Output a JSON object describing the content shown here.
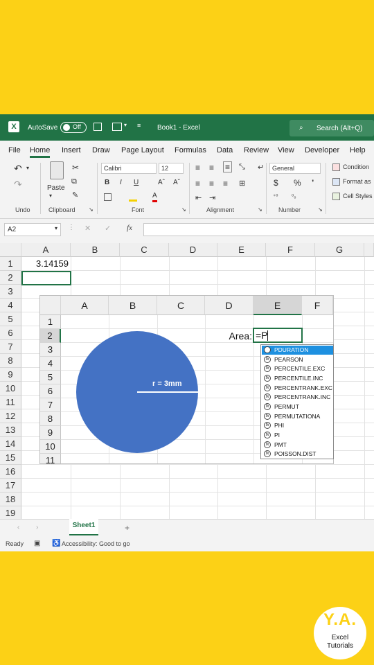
{
  "app": {
    "autosave_label": "AutoSave",
    "autosave_state": "Off",
    "title": "Book1 - Excel",
    "search_placeholder": "Search (Alt+Q)"
  },
  "menu": [
    "File",
    "Home",
    "Insert",
    "Draw",
    "Page Layout",
    "Formulas",
    "Data",
    "Review",
    "View",
    "Developer",
    "Help"
  ],
  "ribbon": {
    "groups": [
      "Undo",
      "Clipboard",
      "Font",
      "Alignment",
      "Number"
    ],
    "paste_label": "Paste",
    "font_name": "Calibri",
    "font_size": "12",
    "bold": "B",
    "italic": "I",
    "underline": "U",
    "grow_font": "Aˆ",
    "shrink_font": "Aˇ",
    "number_format": "General",
    "currency": "$",
    "percent": "%",
    "comma": "ʼ",
    "styles": [
      "Conditional Formatting",
      "Format as Table",
      "Cell Styles"
    ],
    "styles_cut": [
      "Condition",
      "Format as",
      "Cell Styles"
    ],
    "accent": "#217346"
  },
  "formula_bar": {
    "name_box": "A2",
    "fx": "fx",
    "value": ""
  },
  "sheet": {
    "columns": [
      "A",
      "B",
      "C",
      "D",
      "E",
      "F",
      "G"
    ],
    "rows": [
      "1",
      "2",
      "3",
      "4",
      "5",
      "6",
      "7",
      "8",
      "9",
      "10",
      "11",
      "12",
      "13",
      "14",
      "15",
      "16",
      "17",
      "18",
      "19"
    ],
    "a1_value": "3.14159",
    "tab_name": "Sheet1"
  },
  "status": {
    "ready": "Ready",
    "accessibility": "Accessibility: Good to go"
  },
  "zoom_view": {
    "columns": [
      "A",
      "B",
      "C",
      "D",
      "E",
      "F"
    ],
    "rows": [
      "1",
      "2",
      "3",
      "4",
      "5",
      "6",
      "7",
      "8",
      "9",
      "10",
      "11"
    ],
    "area_label": "Area:",
    "cell_input": "=P",
    "circle_label": "r = 3mm",
    "circle_color": "#4472c4",
    "autocomplete": [
      "PDURATION",
      "PEARSON",
      "PERCENTILE.EXC",
      "PERCENTILE.INC",
      "PERCENTRANK.EXC",
      "PERCENTRANK.INC",
      "PERMUT",
      "PERMUTATIONA",
      "PHI",
      "PI",
      "PMT",
      "POISSON.DIST"
    ],
    "selected_index": 0
  },
  "logo": {
    "initials": "Y.A.",
    "line1": "Excel",
    "line2": "Tutorials"
  },
  "colors": {
    "background": "#fcd116",
    "excel_green": "#217346",
    "selection": "#1e90e0"
  }
}
